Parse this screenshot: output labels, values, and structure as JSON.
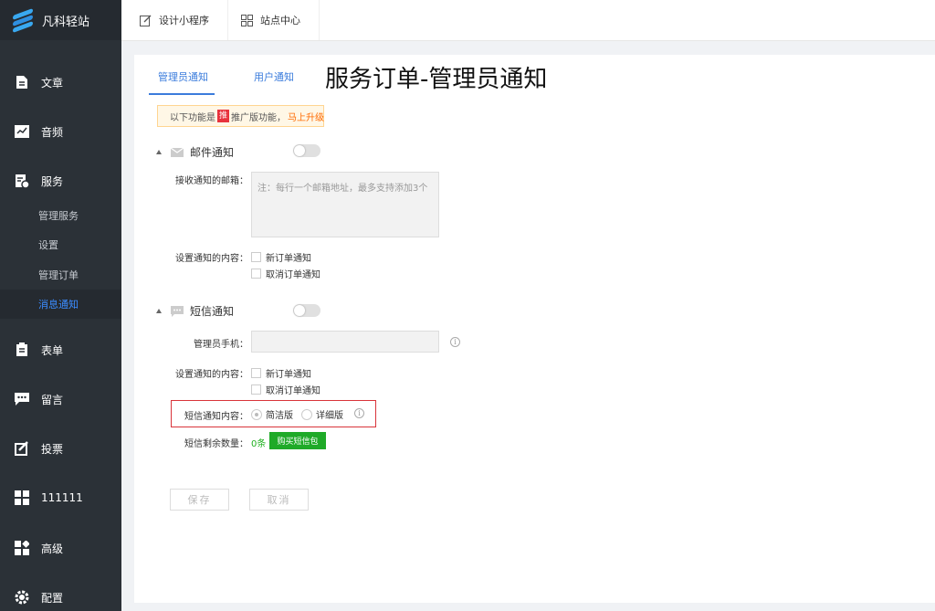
{
  "app": {
    "name": "凡科轻站"
  },
  "sidebar": {
    "items": [
      {
        "label": "文章",
        "icon": "document-icon"
      },
      {
        "label": "音频",
        "icon": "audio-icon"
      },
      {
        "label": "服务",
        "icon": "service-icon"
      },
      {
        "label": "表单",
        "icon": "form-icon"
      },
      {
        "label": "留言",
        "icon": "message-icon"
      },
      {
        "label": "投票",
        "icon": "vote-icon"
      },
      {
        "label": "111111",
        "icon": "grid-icon"
      },
      {
        "label": "高级",
        "icon": "advanced-icon"
      },
      {
        "label": "配置",
        "icon": "settings-icon"
      }
    ],
    "service_sub": [
      "管理服务",
      "设置",
      "管理订单",
      "消息通知"
    ],
    "active_sub": "消息通知"
  },
  "topbar": {
    "design_label": "设计小程序",
    "site_label": "站点中心"
  },
  "tabs": {
    "admin": "管理员通知",
    "user": "用户通知"
  },
  "overlay_title": "服务订单-管理员通知",
  "notice": {
    "prefix": "以下功能是",
    "badge": "推",
    "suffix": "推广版功能，",
    "upgrade": "马上升级"
  },
  "email": {
    "title": "邮件通知",
    "receive_label": "接收通知的邮箱：",
    "placeholder": "注：每行一个邮箱地址，最多支持添加3个",
    "content_label": "设置通知的内容：",
    "opt_new": "新订单通知",
    "opt_cancel": "取消订单通知"
  },
  "sms": {
    "title": "短信通知",
    "phone_label": "管理员手机：",
    "content_label": "设置通知的内容：",
    "opt_new": "新订单通知",
    "opt_cancel": "取消订单通知",
    "sms_content_label": "短信通知内容：",
    "radio_simple": "简洁版",
    "radio_detail": "详细版",
    "remaining_label": "短信剩余数量：",
    "remaining_count": "0条",
    "buy_label": "购买短信包"
  },
  "actions": {
    "save": "保存",
    "cancel": "取消"
  },
  "colors": {
    "accent": "#3b7cdc",
    "sidebar": "#2b3137",
    "green": "#1faa28",
    "highlight": "#d9343a"
  }
}
